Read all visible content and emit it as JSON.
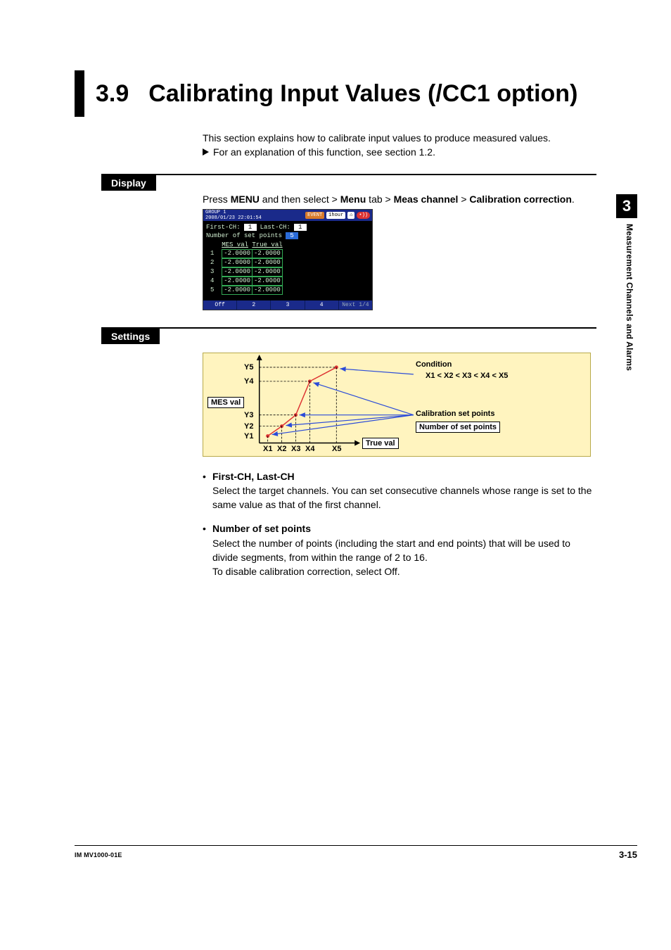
{
  "heading": {
    "num": "3.9",
    "title": "Calibrating Input Values (/CC1 option)"
  },
  "side": {
    "chapter_num": "3",
    "chapter_title": "Measurement Channels and Alarms"
  },
  "intro": {
    "line1": "This section explains how to calibrate input values to produce measured values.",
    "line2": "For an explanation of this function, see section 1.2."
  },
  "sections": {
    "display": "Display",
    "settings": "Settings"
  },
  "display_path": {
    "prefix": "Press ",
    "menu1": "MENU",
    "sep1": " and then select > ",
    "menu2": "Menu",
    "sep2": " tab > ",
    "menu3": "Meas channel",
    "sep3": " > ",
    "menu4": "Calibration correction",
    "suffix": "."
  },
  "device": {
    "group": "GROUP 1",
    "timestamp": "2008/01/23 22:01:54",
    "top_pill1": "EVENT",
    "top_pill2": "1hour",
    "first_ch_label": "First-CH:",
    "first_ch_val": "1",
    "last_ch_label": "Last-CH:",
    "last_ch_val": "1",
    "nsp_label": "Number of set points",
    "nsp_val": "5",
    "col1": "MES val",
    "col2": "True val",
    "rows": [
      {
        "n": "1",
        "m": "-2.0000",
        "t": "-2.0000"
      },
      {
        "n": "2",
        "m": "-2.0000",
        "t": "-2.0000"
      },
      {
        "n": "3",
        "m": "-2.0000",
        "t": "-2.0000"
      },
      {
        "n": "4",
        "m": "-2.0000",
        "t": "-2.0000"
      },
      {
        "n": "5",
        "m": "-2.0000",
        "t": "-2.0000"
      }
    ],
    "btns": [
      "Off",
      "2",
      "3",
      "4",
      "Next 1/4"
    ]
  },
  "diagram": {
    "y_labels": [
      "Y5",
      "Y4",
      "Y3",
      "Y2",
      "Y1"
    ],
    "x_labels": [
      "X1",
      "X2",
      "X3",
      "X4",
      "X5"
    ],
    "mes_box": "MES val",
    "true_box": "True val",
    "cond_head": "Condition",
    "cond_expr": "X1 < X2 < X3 < X4 < X5",
    "cal_lbl": "Calibration set points",
    "nsp_box": "Number of set points"
  },
  "chart_data": {
    "type": "line",
    "title": "",
    "xlabel": "True val",
    "ylabel": "MES val",
    "categories": [
      "X1",
      "X2",
      "X3",
      "X4",
      "X5"
    ],
    "series": [
      {
        "name": "Calibration set points",
        "values": [
          "Y1",
          "Y2",
          "Y3",
          "Y4",
          "Y5"
        ]
      }
    ],
    "annotations": [
      "Condition: X1 < X2 < X3 < X4 < X5",
      "Number of set points"
    ]
  },
  "body": {
    "b1_head": "First-CH, Last-CH",
    "b1_p": "Select the target channels. You can set consecutive channels whose range is set to the same value as that of the first channel.",
    "b2_head": "Number of set points",
    "b2_p1": "Select the number of points (including the start and end points) that will be used to divide segments, from within the range of 2 to 16.",
    "b2_p2": "To disable calibration correction, select Off."
  },
  "footer": {
    "doc_id": "IM MV1000-01E",
    "page": "3-15"
  }
}
